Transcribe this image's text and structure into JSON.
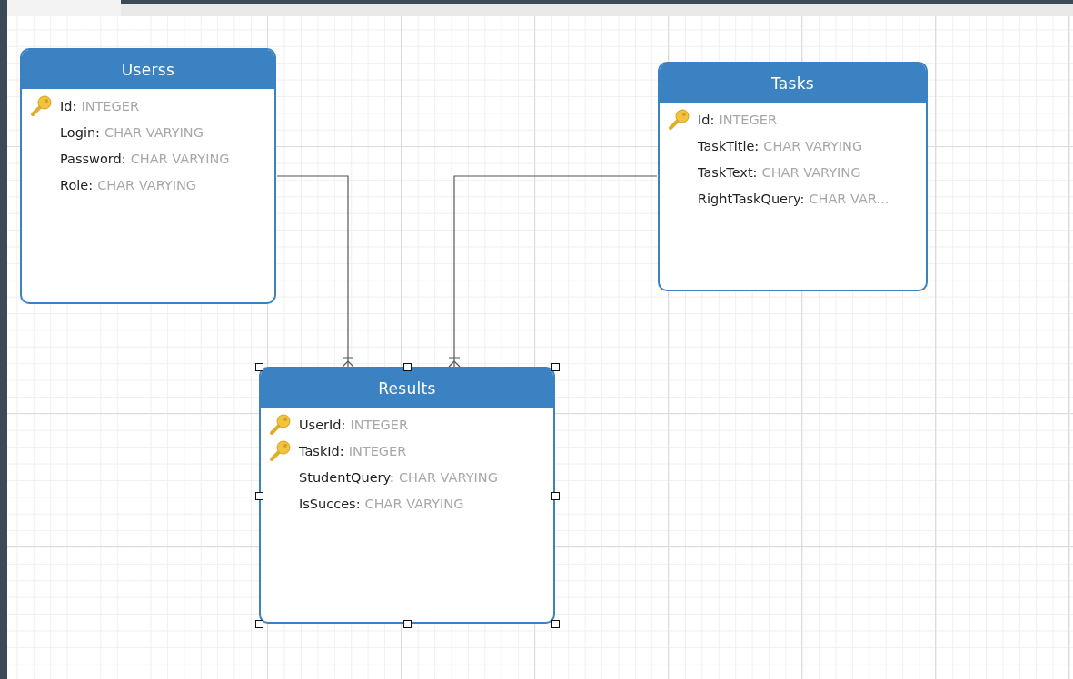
{
  "tables": [
    {
      "name": "Userss",
      "selected": false,
      "fields": [
        {
          "name": "Id:",
          "type": "INTEGER",
          "key": true
        },
        {
          "name": "Login:",
          "type": "CHAR VARYING",
          "key": false
        },
        {
          "name": "Password:",
          "type": "CHAR VARYING",
          "key": false
        },
        {
          "name": "Role:",
          "type": "CHAR VARYING",
          "key": false
        }
      ]
    },
    {
      "name": "Tasks",
      "selected": false,
      "fields": [
        {
          "name": "Id:",
          "type": "INTEGER",
          "key": true
        },
        {
          "name": "TaskTitle:",
          "type": "CHAR VARYING",
          "key": false
        },
        {
          "name": "TaskText:",
          "type": "CHAR VARYING",
          "key": false
        },
        {
          "name": "RightTaskQuery:",
          "type": "CHAR VAR...",
          "key": false
        }
      ]
    },
    {
      "name": "Results",
      "selected": true,
      "fields": [
        {
          "name": "UserId:",
          "type": "INTEGER",
          "key": true
        },
        {
          "name": "TaskId:",
          "type": "INTEGER",
          "key": true
        },
        {
          "name": "StudentQuery:",
          "type": "CHAR VARYING",
          "key": false
        },
        {
          "name": "IsSucces:",
          "type": "CHAR VARYING",
          "key": false
        }
      ]
    }
  ]
}
